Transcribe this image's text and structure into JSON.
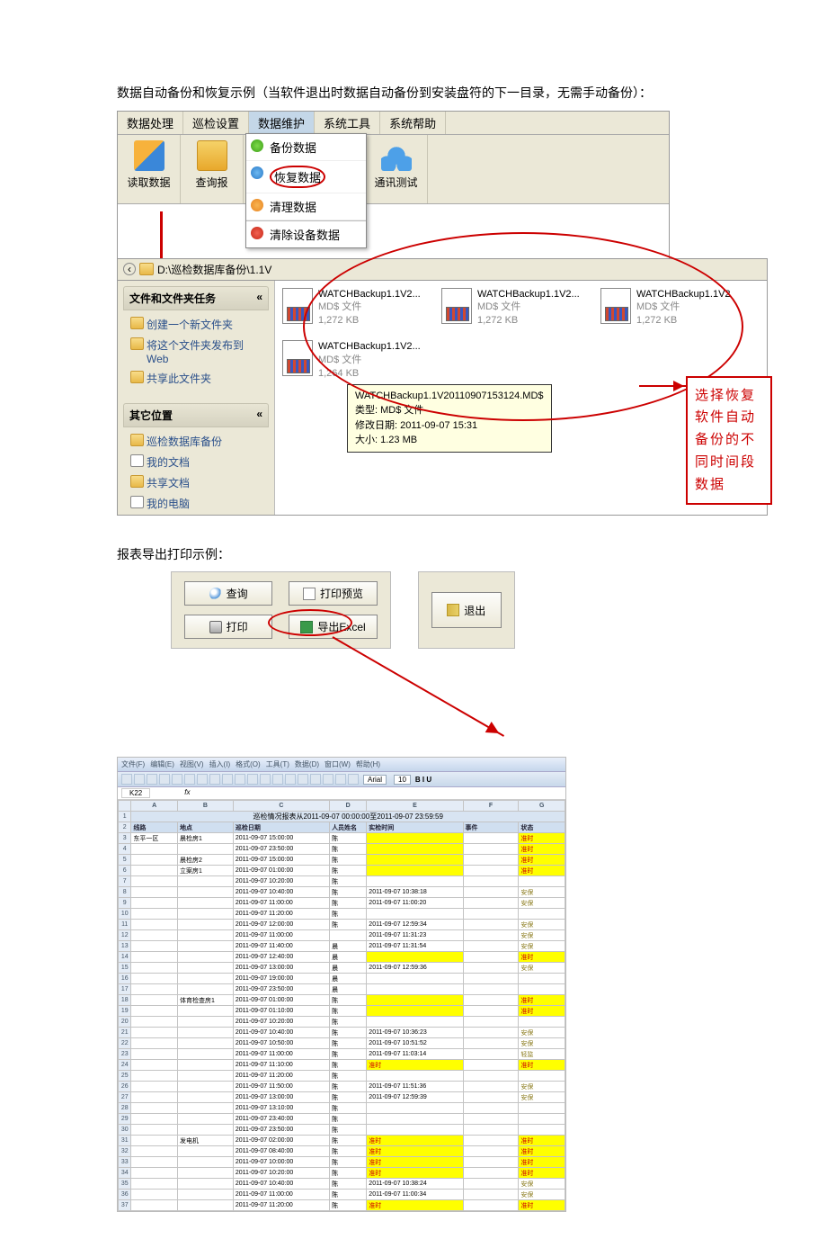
{
  "section1": {
    "caption": "数据自动备份和恢复示例（当软件退出时数据自动备份到安装盘符的下一目录，无需手动备份）：",
    "menus": [
      "数据处理",
      "巡检设置",
      "数据维护",
      "系统工具",
      "系统帮助"
    ],
    "toolbar": {
      "read": "读取数据",
      "query": "查询报",
      "comm": "通讯测试"
    },
    "dropdown": {
      "m1": "备份数据",
      "m2": "恢复数据",
      "m3": "清理数据",
      "m4": "清除设备数据"
    },
    "path": "D:\\巡检数据库备份\\1.1V",
    "sidebar": {
      "h1": "文件和文件夹任务",
      "t1": "创建一个新文件夹",
      "t2": "将这个文件夹发布到 Web",
      "t3": "共享此文件夹",
      "h2": "其它位置",
      "p1": "巡检数据库备份",
      "p2": "我的文档",
      "p3": "共享文档",
      "p4": "我的电脑"
    },
    "files": [
      {
        "n": "WATCHBackup1.1V2...",
        "t": "MD$ 文件",
        "s": "1,272 KB"
      },
      {
        "n": "WATCHBackup1.1V2...",
        "t": "MD$ 文件",
        "s": "1,272 KB"
      },
      {
        "n": "WATCHBackup1.1V2",
        "t": "MD$ 文件",
        "s": "1,272 KB"
      },
      {
        "n": "WATCHBackup1.1V2...",
        "t": "MD$ 文件",
        "s": "1,264 KB"
      }
    ],
    "tooltip": {
      "l1": "WATCHBackup1.1V20110907153124.MD$",
      "l2": "类型: MD$ 文件",
      "l3": "修改日期: 2011-09-07 15:31",
      "l4": "大小: 1.23 MB"
    },
    "callout": "选择恢复软件自动备份的不同时间段数据",
    "chev": "«"
  },
  "section2": {
    "caption": "报表导出打印示例：",
    "btns": {
      "find": "查询",
      "preview": "打印预览",
      "print": "打印",
      "excel": "导出Excel",
      "exit": "退出"
    },
    "excel": {
      "menus": [
        "文件(F)",
        "编辑(E)",
        "视图(V)",
        "插入(I)",
        "格式(O)",
        "工具(T)",
        "数据(D)",
        "窗口(W)",
        "帮助(H)"
      ],
      "font": "Arial",
      "size": "10",
      "style": "B  I  U",
      "cell": "K22",
      "fx": "fx",
      "title": "巡检情况报表从2011-09-07 00:00:00至2011-09-07 23:59:59",
      "cols": [
        "",
        "A",
        "B",
        "C",
        "D",
        "E",
        "F",
        "G"
      ],
      "headers": [
        "",
        "线路",
        "地点",
        "巡检日期",
        "人员姓名",
        "实检时间",
        "事件",
        "状态"
      ],
      "rows": [
        [
          "3",
          "东平一区",
          "晨检房1",
          "2011-09-07 15:00:00",
          "陈",
          "",
          "",
          "准时"
        ],
        [
          "4",
          "",
          "",
          "2011-09-07 23:50:00",
          "陈",
          "",
          "",
          "准时"
        ],
        [
          "5",
          "",
          "晨检房2",
          "2011-09-07 15:00:00",
          "陈",
          "",
          "",
          "准时"
        ],
        [
          "6",
          "",
          "立案房1",
          "2011-09-07 01:00:00",
          "陈",
          "",
          "",
          "准时"
        ],
        [
          "7",
          "",
          "",
          "2011-09-07 10:20:00",
          "陈",
          "",
          "",
          ""
        ],
        [
          "8",
          "",
          "",
          "2011-09-07 10:40:00",
          "陈",
          "2011-09-07 10:38:18",
          "",
          "安保"
        ],
        [
          "9",
          "",
          "",
          "2011-09-07 11:00:00",
          "陈",
          "2011-09-07 11:00:20",
          "",
          "安保"
        ],
        [
          "10",
          "",
          "",
          "2011-09-07 11:20:00",
          "陈",
          "",
          "",
          ""
        ],
        [
          "11",
          "",
          "",
          "2011-09-07 12:00:00",
          "陈",
          "2011-09-07 12:59:34",
          "",
          "安保"
        ],
        [
          "12",
          "",
          "",
          "2011-09-07 11:00:00",
          "",
          "2011-09-07 11:31:23",
          "",
          "安保"
        ],
        [
          "13",
          "",
          "",
          "2011-09-07 11:40:00",
          "晨",
          "2011-09-07 11:31:54",
          "",
          "安保"
        ],
        [
          "14",
          "",
          "",
          "2011-09-07 12:40:00",
          "晨",
          "",
          "",
          "准时"
        ],
        [
          "15",
          "",
          "",
          "2011-09-07 13:00:00",
          "晨",
          "2011-09-07 12:59:36",
          "",
          "安保"
        ],
        [
          "16",
          "",
          "",
          "2011-09-07 19:00:00",
          "晨",
          "",
          "",
          ""
        ],
        [
          "17",
          "",
          "",
          "2011-09-07 23:50:00",
          "晨",
          "",
          "",
          ""
        ],
        [
          "18",
          "",
          "体育检查房1",
          "2011-09-07 01:00:00",
          "陈",
          "",
          "",
          "准时"
        ],
        [
          "19",
          "",
          "",
          "2011-09-07 01:10:00",
          "陈",
          "",
          "",
          "准时"
        ],
        [
          "20",
          "",
          "",
          "2011-09-07 10:20:00",
          "陈",
          "",
          "",
          ""
        ],
        [
          "21",
          "",
          "",
          "2011-09-07 10:40:00",
          "陈",
          "2011-09-07 10:36:23",
          "",
          "安保"
        ],
        [
          "22",
          "",
          "",
          "2011-09-07 10:50:00",
          "陈",
          "2011-09-07 10:51:52",
          "",
          "安保"
        ],
        [
          "23",
          "",
          "",
          "2011-09-07 11:00:00",
          "陈",
          "2011-09-07 11:03:14",
          "",
          "轻监"
        ],
        [
          "24",
          "",
          "",
          "2011-09-07 11:10:00",
          "陈",
          "准时",
          "",
          "准时"
        ],
        [
          "25",
          "",
          "",
          "2011-09-07 11:20:00",
          "陈",
          "",
          "",
          ""
        ],
        [
          "26",
          "",
          "",
          "2011-09-07 11:50:00",
          "陈",
          "2011-09-07 11:51:36",
          "",
          "安保"
        ],
        [
          "27",
          "",
          "",
          "2011-09-07 13:00:00",
          "陈",
          "2011-09-07 12:59:39",
          "",
          "安保"
        ],
        [
          "28",
          "",
          "",
          "2011-09-07 13:10:00",
          "陈",
          "",
          "",
          ""
        ],
        [
          "29",
          "",
          "",
          "2011-09-07 23:40:00",
          "陈",
          "",
          "",
          ""
        ],
        [
          "30",
          "",
          "",
          "2011-09-07 23:50:00",
          "陈",
          "",
          "",
          ""
        ],
        [
          "31",
          "",
          "发电机",
          "2011-09-07 02:00:00",
          "陈",
          "准时",
          "",
          "准时"
        ],
        [
          "32",
          "",
          "",
          "2011-09-07 08:40:00",
          "陈",
          "准时",
          "",
          "准时"
        ],
        [
          "33",
          "",
          "",
          "2011-09-07 10:00:00",
          "陈",
          "准时",
          "",
          "准时"
        ],
        [
          "34",
          "",
          "",
          "2011-09-07 10:20:00",
          "陈",
          "准时",
          "",
          "准时"
        ],
        [
          "35",
          "",
          "",
          "2011-09-07 10:40:00",
          "陈",
          "2011-09-07 10:38:24",
          "",
          "安保"
        ],
        [
          "36",
          "",
          "",
          "2011-09-07 11:00:00",
          "陈",
          "2011-09-07 11:00:34",
          "",
          "安保"
        ],
        [
          "37",
          "",
          "",
          "2011-09-07 11:20:00",
          "陈",
          "准时",
          "",
          "准时"
        ]
      ]
    }
  }
}
